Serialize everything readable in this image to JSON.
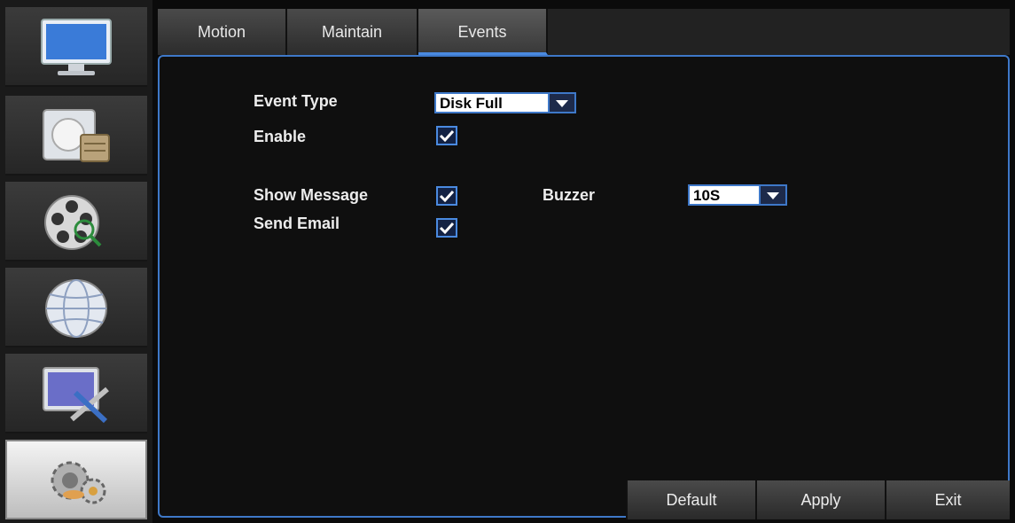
{
  "sidebar": {
    "items": [
      {
        "icon": "monitor-icon",
        "active": false
      },
      {
        "icon": "record-icon",
        "active": false
      },
      {
        "icon": "film-reel-search-icon",
        "active": false
      },
      {
        "icon": "network-globe-icon",
        "active": false
      },
      {
        "icon": "system-tools-icon",
        "active": false
      },
      {
        "icon": "advanced-gears-icon",
        "active": true
      }
    ]
  },
  "tabs": [
    {
      "label": "Motion",
      "active": false
    },
    {
      "label": "Maintain",
      "active": false
    },
    {
      "label": "Events",
      "active": true
    }
  ],
  "form": {
    "event_type_label": "Event Type",
    "event_type_value": "Disk Full",
    "enable_label": "Enable",
    "enable_checked": true,
    "show_message_label": "Show Message",
    "show_message_checked": true,
    "buzzer_label": "Buzzer",
    "buzzer_value": "10S",
    "send_email_label": "Send Email",
    "send_email_checked": true
  },
  "buttons": {
    "default_label": "Default",
    "apply_label": "Apply",
    "exit_label": "Exit"
  },
  "colors": {
    "accent": "#3e78c8",
    "background": "#0f0f0f",
    "text": "#ececec"
  }
}
